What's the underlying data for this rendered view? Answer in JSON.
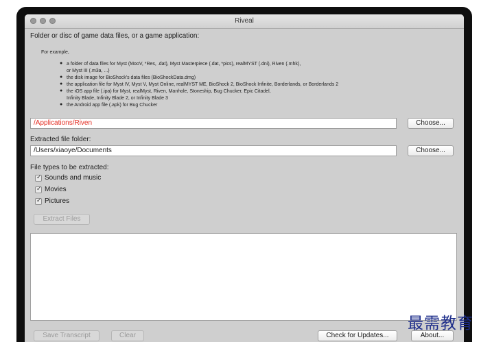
{
  "window": {
    "title": "Riveal"
  },
  "source": {
    "heading": "Folder or disc of game data files, or a game application:",
    "example_intro": "For example,",
    "examples": [
      "a folder of data files for Myst (MooV, *Res, .dat), Myst Masterpiece (.dat, *pics), realMYST (.dni), Riven (.mhk),",
      "or Myst III (.m3a, ...)",
      "the disk image for BioShock's data files (BioShockData.dmg)",
      "the application file for Myst IV, Myst V, Myst Online, realMYST ME, BioShock 2, BioShock Infinite, Borderlands, or Borderlands 2",
      "the iOS app file (.ipa) for Myst, realMyst, Riven, Manhole, Stoneship, Bug Chucker, Epic Citadel,",
      "Infinity Blade, Infinity Blade 2, or Infinity Blade 3",
      "the Android app file (.apk) for Bug Chucker"
    ],
    "path_value": "/Applications/Riven",
    "path_color": "#e32b20",
    "choose_label": "Choose..."
  },
  "output": {
    "heading": "Extracted file folder:",
    "path_value": "/Users/xiaoye/Documents",
    "choose_label": "Choose..."
  },
  "filetypes": {
    "heading": "File types to be extracted:",
    "items": [
      {
        "label": "Sounds and music",
        "checked": true
      },
      {
        "label": "Movies",
        "checked": true
      },
      {
        "label": "Pictures",
        "checked": true
      }
    ]
  },
  "buttons": {
    "extract": "Extract Files",
    "save_transcript": "Save Transcript",
    "clear": "Clear",
    "check_updates": "Check for Updates...",
    "about": "About..."
  },
  "watermark": {
    "text": "最需教育"
  }
}
